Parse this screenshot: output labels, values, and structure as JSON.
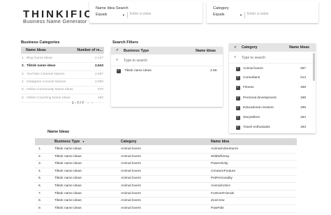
{
  "header": {
    "logo": "THINKIFIC",
    "subtitle": "Business Name Generator"
  },
  "filters": {
    "name_search": {
      "label": "Name Idea Search",
      "operator": "Equals",
      "placeholder": "Enter a value"
    },
    "category": {
      "label": "Category",
      "operator": "Equals",
      "placeholder": "Enter a value"
    }
  },
  "business_categories": {
    "title": "Business Categories",
    "col_name": "Name Ideas",
    "col_count": "Number of re...",
    "rows": [
      {
        "n": "1.",
        "name": "Blog Name Ideas",
        "count": "2,137"
      },
      {
        "n": "2.",
        "name": "Tiktok name ideas",
        "count": "2,543"
      },
      {
        "n": "3.",
        "name": "YouTube Channel Names",
        "count": "2,067"
      },
      {
        "n": "4.",
        "name": "Instagram Account Names",
        "count": "2,050"
      },
      {
        "n": "5.",
        "name": "Online Community Name Ideas",
        "count": "670"
      },
      {
        "n": "6.",
        "name": "Online Coaching Name Ideas",
        "count": "460"
      }
    ],
    "pager": "1 - 7 / 7"
  },
  "search_filters": {
    "title": "Search Filters",
    "col_type": "Business Type",
    "col_ideas": "Name Ideas",
    "search_placeholder": "Type to search",
    "items": [
      {
        "label": "Tiktok name ideas",
        "count": "2.5K"
      }
    ]
  },
  "category_panel": {
    "col_category": "Category",
    "col_ideas": "Name Ideas",
    "search_placeholder": "Type to search",
    "items": [
      {
        "label": "Animal lovers",
        "count": "287"
      },
      {
        "label": "Comedians",
        "count": "214"
      },
      {
        "label": "Fitness",
        "count": "198"
      },
      {
        "label": "Personal development",
        "count": "198"
      },
      {
        "label": "Educational creators",
        "count": "195"
      },
      {
        "label": "Storytellers",
        "count": "194"
      },
      {
        "label": "Travel enthusiasts",
        "count": "193"
      }
    ]
  },
  "name_ideas_table": {
    "title": "Name Ideas",
    "col_type": "Business Type",
    "col_category": "Category",
    "col_name": "Name Idea",
    "sort_icon": "▼",
    "rows": [
      {
        "n": "1.",
        "type": "Tiktok name ideas",
        "category": "Animal lovers",
        "name": "AnimalAdventures"
      },
      {
        "n": "2.",
        "type": "Tiktok name ideas",
        "category": "Animal lovers",
        "name": "WildWhimsy"
      },
      {
        "n": "3.",
        "type": "Tiktok name ideas",
        "category": "Animal lovers",
        "name": "PawsAtivity"
      },
      {
        "n": "4.",
        "type": "Tiktok name ideas",
        "category": "Animal lovers",
        "name": "CreatureFeature"
      },
      {
        "n": "5.",
        "type": "Tiktok name ideas",
        "category": "Animal lovers",
        "name": "PetPersonality"
      },
      {
        "n": "6.",
        "type": "Tiktok name ideas",
        "category": "Animal lovers",
        "name": "AnimalAntics"
      },
      {
        "n": "7.",
        "type": "Tiktok name ideas",
        "category": "Animal lovers",
        "name": "FurEverFriends"
      },
      {
        "n": "8.",
        "type": "Tiktok name ideas",
        "category": "Animal lovers",
        "name": "ZooCrew"
      },
      {
        "n": "9.",
        "type": "Tiktok name ideas",
        "category": "Animal lovers",
        "name": "PawPals"
      }
    ]
  }
}
